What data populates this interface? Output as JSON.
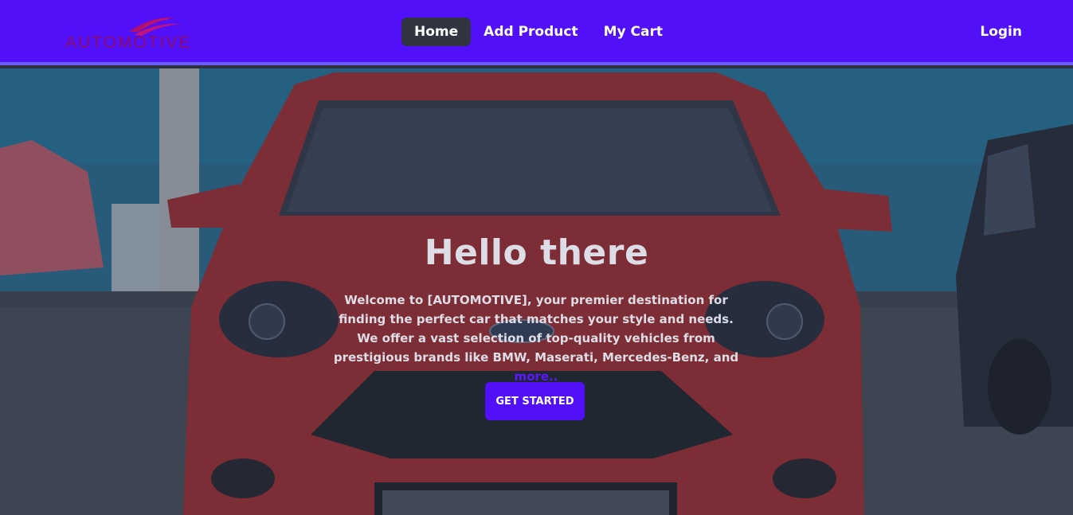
{
  "brand": {
    "name": "AUTOMOTIVE",
    "logo_icon": "swoosh-icon",
    "color": "#8a0a6a"
  },
  "nav": {
    "items": [
      {
        "label": "Home",
        "active": true
      },
      {
        "label": "Add Product",
        "active": false
      },
      {
        "label": "My Cart",
        "active": false
      }
    ],
    "login_label": "Login",
    "background": "#5210f8"
  },
  "hero": {
    "title": "Hello there",
    "text_main": "Welcome to [AUTOMOTIVE], your premier destination for finding the perfect car that matches your style and needs. We offer a vast selection of top-quality vehicles from prestigious brands like BMW, Maserati, Mercedes-Benz, and ",
    "more_label": "more..",
    "cta_label": "GET STARTED",
    "background_image": "red-car-front-photo"
  }
}
